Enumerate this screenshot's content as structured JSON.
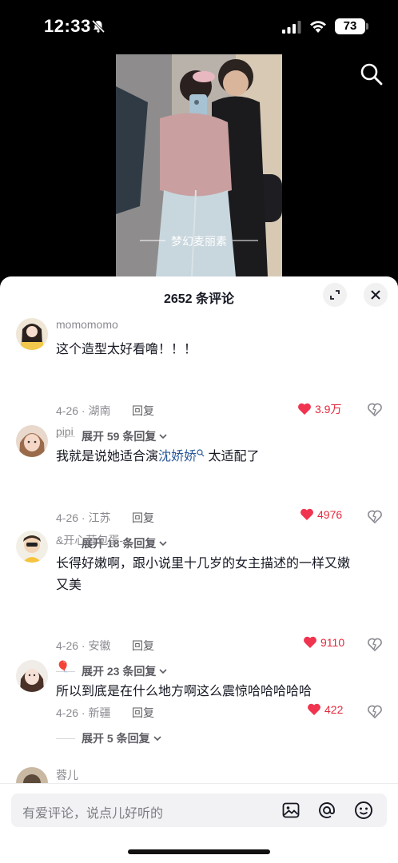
{
  "status_bar": {
    "time": "12:33",
    "battery": "73"
  },
  "video": {
    "caption": "梦幻麦丽素"
  },
  "comments_panel": {
    "title": "2652 条评论",
    "reply_label": "回复",
    "comments": [
      {
        "user": "momomomo",
        "text": "这个造型太好看噜！！！",
        "date_loc": "4-26 · 湖南",
        "likes": "3.9万",
        "more": "展开 59 条回复"
      },
      {
        "user": "pipi",
        "text_before": "我就是说她适合演",
        "hashtag": "沈娇娇",
        "text_after": " 太适配了",
        "date_loc": "4-26 · 江苏",
        "likes": "4976",
        "more": "展开 18 条回复"
      },
      {
        "user": "&开心荷包蛋-",
        "text": "长得好嫩啊，跟小说里十几岁的女主描述的一样又嫩又美",
        "date_loc": "4-26 · 安徽",
        "likes": "9110",
        "more": "展开 23 条回复"
      },
      {
        "user": "🎈",
        "text": "所以到底是在什么地方啊这么震惊哈哈哈哈哈",
        "date_loc": "4-26 · 新疆",
        "likes": "422",
        "more": "展开 5 条回复"
      },
      {
        "user": "蓉儿"
      }
    ]
  },
  "input": {
    "placeholder": "有爱评论，说点儿好听的"
  }
}
